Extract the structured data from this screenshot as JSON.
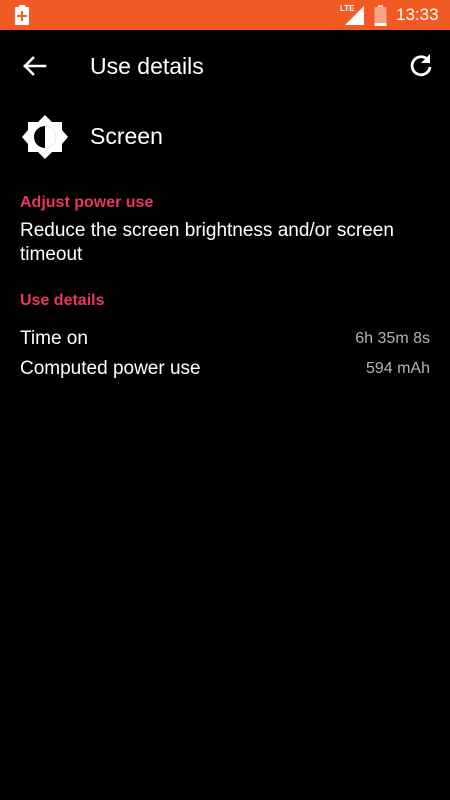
{
  "status_bar": {
    "network_type": "LTE",
    "time": "13:33",
    "color": "#f15a22"
  },
  "toolbar": {
    "back_icon": "arrow-back-icon",
    "title": "Use details",
    "refresh_icon": "refresh-icon"
  },
  "app": {
    "icon": "brightness-icon",
    "name": "Screen"
  },
  "adjust_section": {
    "header": "Adjust power use",
    "body": "Reduce the screen brightness and/or screen timeout",
    "accent_color": "#e8385e"
  },
  "details_section": {
    "header": "Use details",
    "rows": [
      {
        "label": "Time on",
        "value": "6h 35m 8s"
      },
      {
        "label": "Computed power use",
        "value": "594 mAh"
      }
    ]
  }
}
